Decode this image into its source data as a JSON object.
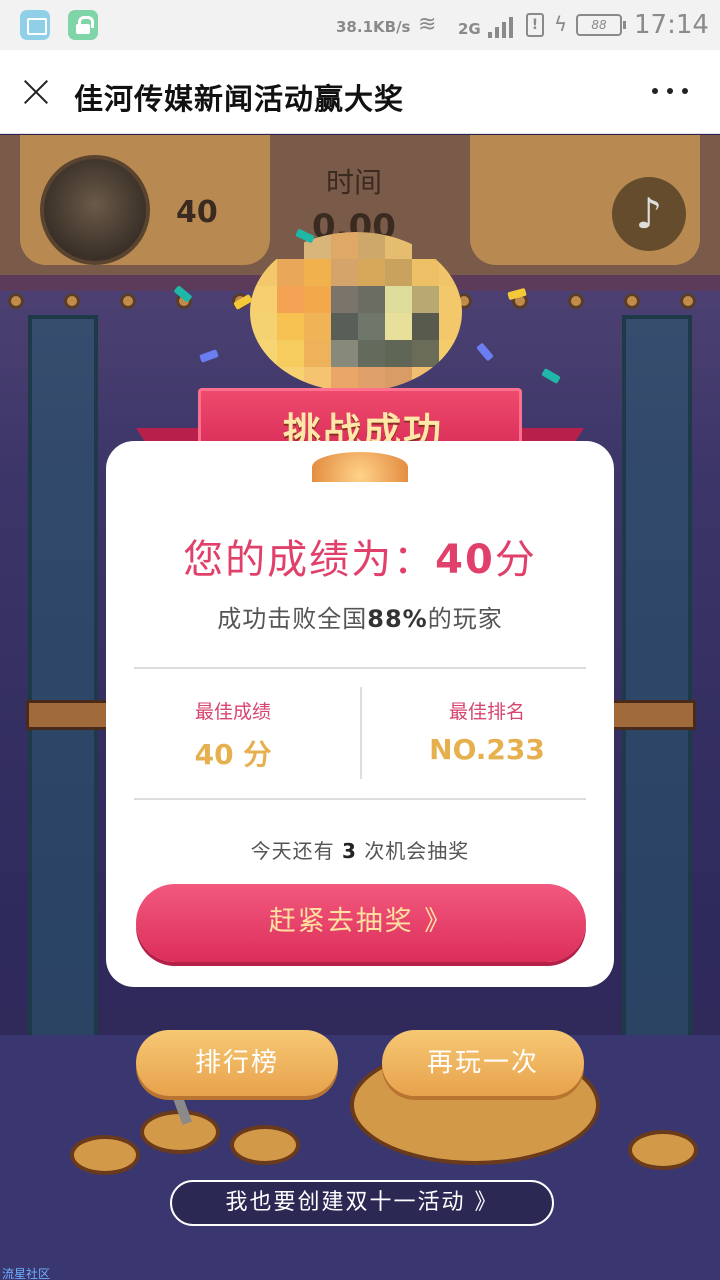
{
  "status_bar": {
    "speed": "38.1KB/s",
    "network": "2G",
    "battery": "88",
    "time": "17:14"
  },
  "header": {
    "title": "佳河传媒新闻活动赢大奖"
  },
  "game_bg": {
    "score": "40",
    "time_label": "时间",
    "time_value": "0.00"
  },
  "badge": {
    "title": "挑战成功"
  },
  "result": {
    "score_prefix": "您的成绩为：",
    "score_value": "40",
    "score_unit": "分",
    "beat_prefix": "成功击败全国",
    "beat_percent": "88%",
    "beat_suffix": "的玩家",
    "best_score_label": "最佳成绩",
    "best_score_value": "40 分",
    "best_rank_label": "最佳排名",
    "best_rank_value": "NO.233",
    "chances_prefix": "今天还有",
    "chances_count": "3",
    "chances_suffix": "次机会抽奖",
    "draw_button": "赶紧去抽奖 》"
  },
  "actions": {
    "ranking": "排行榜",
    "replay": "再玩一次",
    "create": "我也要创建双十一活动 》"
  },
  "watermark": "流星社区",
  "colors": {
    "accent_pink": "#e0406a",
    "gold": "#e6b04e",
    "button_gold": "#f0b862"
  }
}
